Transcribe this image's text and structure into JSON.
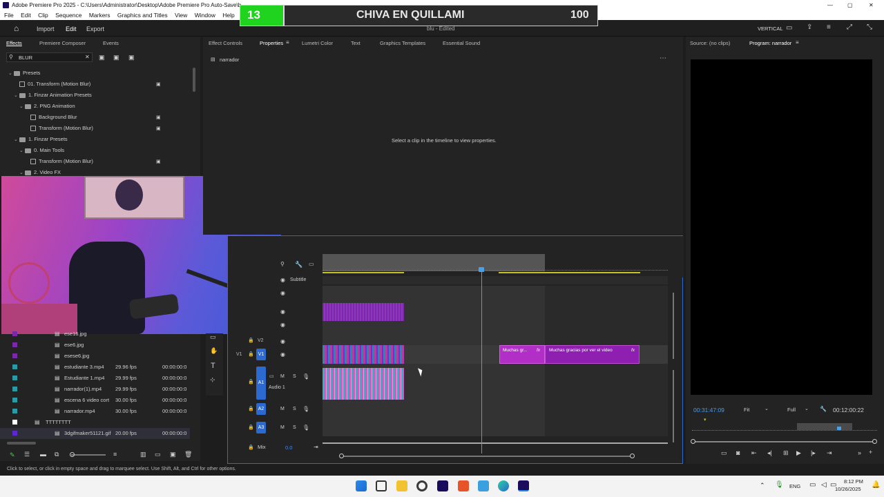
{
  "app": {
    "title": "Adobe Premiere Pro 2025 - C:\\Users\\Administrator\\Desktop\\Adobe Premiere Pro Auto-Save\\b...",
    "doc_title": "blu - Edited",
    "layout": "VERTICAL"
  },
  "menu": [
    "File",
    "Edit",
    "Clip",
    "Sequence",
    "Markers",
    "Graphics and Titles",
    "View",
    "Window",
    "Help"
  ],
  "nav": {
    "home": "home",
    "import": "Import",
    "edit": "Edit",
    "export": "Export"
  },
  "overlay": {
    "score_left": "13",
    "name": "CHIVA EN QUILLAMI",
    "score_right": "100"
  },
  "effects": {
    "tabs": [
      "Effects",
      "Premiere Composer",
      "Events"
    ],
    "search_value": "BLUR",
    "tree": [
      {
        "label": "Presets",
        "indent": 0,
        "kind": "folder",
        "chev": "v"
      },
      {
        "label": "01. Transform (Motion Blur)",
        "indent": 1,
        "kind": "preset",
        "badge": true
      },
      {
        "label": "1. Finzar Animation Presets",
        "indent": 1,
        "kind": "folder",
        "chev": "v"
      },
      {
        "label": "2. PNG Animation",
        "indent": 2,
        "kind": "folder",
        "chev": "v"
      },
      {
        "label": "Background Blur",
        "indent": 3,
        "kind": "preset",
        "badge": true
      },
      {
        "label": "Transform (Motion Blur)",
        "indent": 3,
        "kind": "preset",
        "badge": true
      },
      {
        "label": "1. Finzar Presets",
        "indent": 1,
        "kind": "folder",
        "chev": "v"
      },
      {
        "label": "0. Main Tools",
        "indent": 2,
        "kind": "folder",
        "chev": "v"
      },
      {
        "label": "Transform (Motion Blur)",
        "indent": 3,
        "kind": "preset",
        "badge": true
      },
      {
        "label": "2. Video FX",
        "indent": 2,
        "kind": "folder",
        "chev": "v"
      }
    ]
  },
  "project": {
    "rows": [
      {
        "name": "ese16.jpg",
        "fps": "",
        "time": "",
        "color": "#7a2aa6"
      },
      {
        "name": "ese6.jpg",
        "fps": "",
        "time": "",
        "color": "#7a2aa6"
      },
      {
        "name": "esese6.jpg",
        "fps": "",
        "time": "",
        "color": "#7a2aa6"
      },
      {
        "name": "estudiante 3.mp4",
        "fps": "29.96 fps",
        "time": "00:00:00:0",
        "color": "#2a9aa6"
      },
      {
        "name": "Estudiante 1.mp4",
        "fps": "29.99 fps",
        "time": "00:00:00:0",
        "color": "#2a9aa6"
      },
      {
        "name": "narrador(1).mp4",
        "fps": "29.99 fps",
        "time": "00:00:00:0",
        "color": "#2a9aa6"
      },
      {
        "name": "escena 6 video cort",
        "fps": "30.00 fps",
        "time": "00:00:00:0",
        "color": "#2a9aa6"
      },
      {
        "name": "narrador.mp4",
        "fps": "30.00 fps",
        "time": "00:00:00:0",
        "color": "#2a9aa6"
      },
      {
        "name": "TTTTTTTT",
        "fps": "",
        "time": "",
        "color": "#ffffff"
      },
      {
        "name": "3dgifmaker51121.gif",
        "fps": "20.00 fps",
        "time": "00:00:00:0",
        "color": "#5a2ad0"
      }
    ]
  },
  "properties": {
    "tabs": [
      "Effect Controls",
      "Properties",
      "Lumetri Color",
      "Text",
      "Graphics Templates",
      "Essential Sound"
    ],
    "clip_name": "narrador",
    "empty_message": "Select a clip in the timeline to view properties."
  },
  "timeline": {
    "subtitle_label": "Subtitle",
    "tracks_video": [
      "V2",
      "V1"
    ],
    "tracks_audio": [
      "A1",
      "A2",
      "A3"
    ],
    "audio1_label": "Audio 1",
    "mix_label": "Mix",
    "mix_value": "0.0",
    "clip1": "Muchas gr...",
    "clip2": "Muchas gracias por ver el video",
    "fx": "fx"
  },
  "program": {
    "tabs": [
      "Source: (no clips)",
      "Program: narrador"
    ],
    "timecode_in": "00:31:47:09",
    "fit": "Fit",
    "quality": "Full",
    "timecode_out": "00:12:00:22"
  },
  "status": "Click to select, or click in empty space and drag to marquee select. Use Shift, Alt, and Ctrl for other options.",
  "taskbar": {
    "lang": "ENG",
    "time": "8:12 PM",
    "date": "10/26/2025"
  }
}
